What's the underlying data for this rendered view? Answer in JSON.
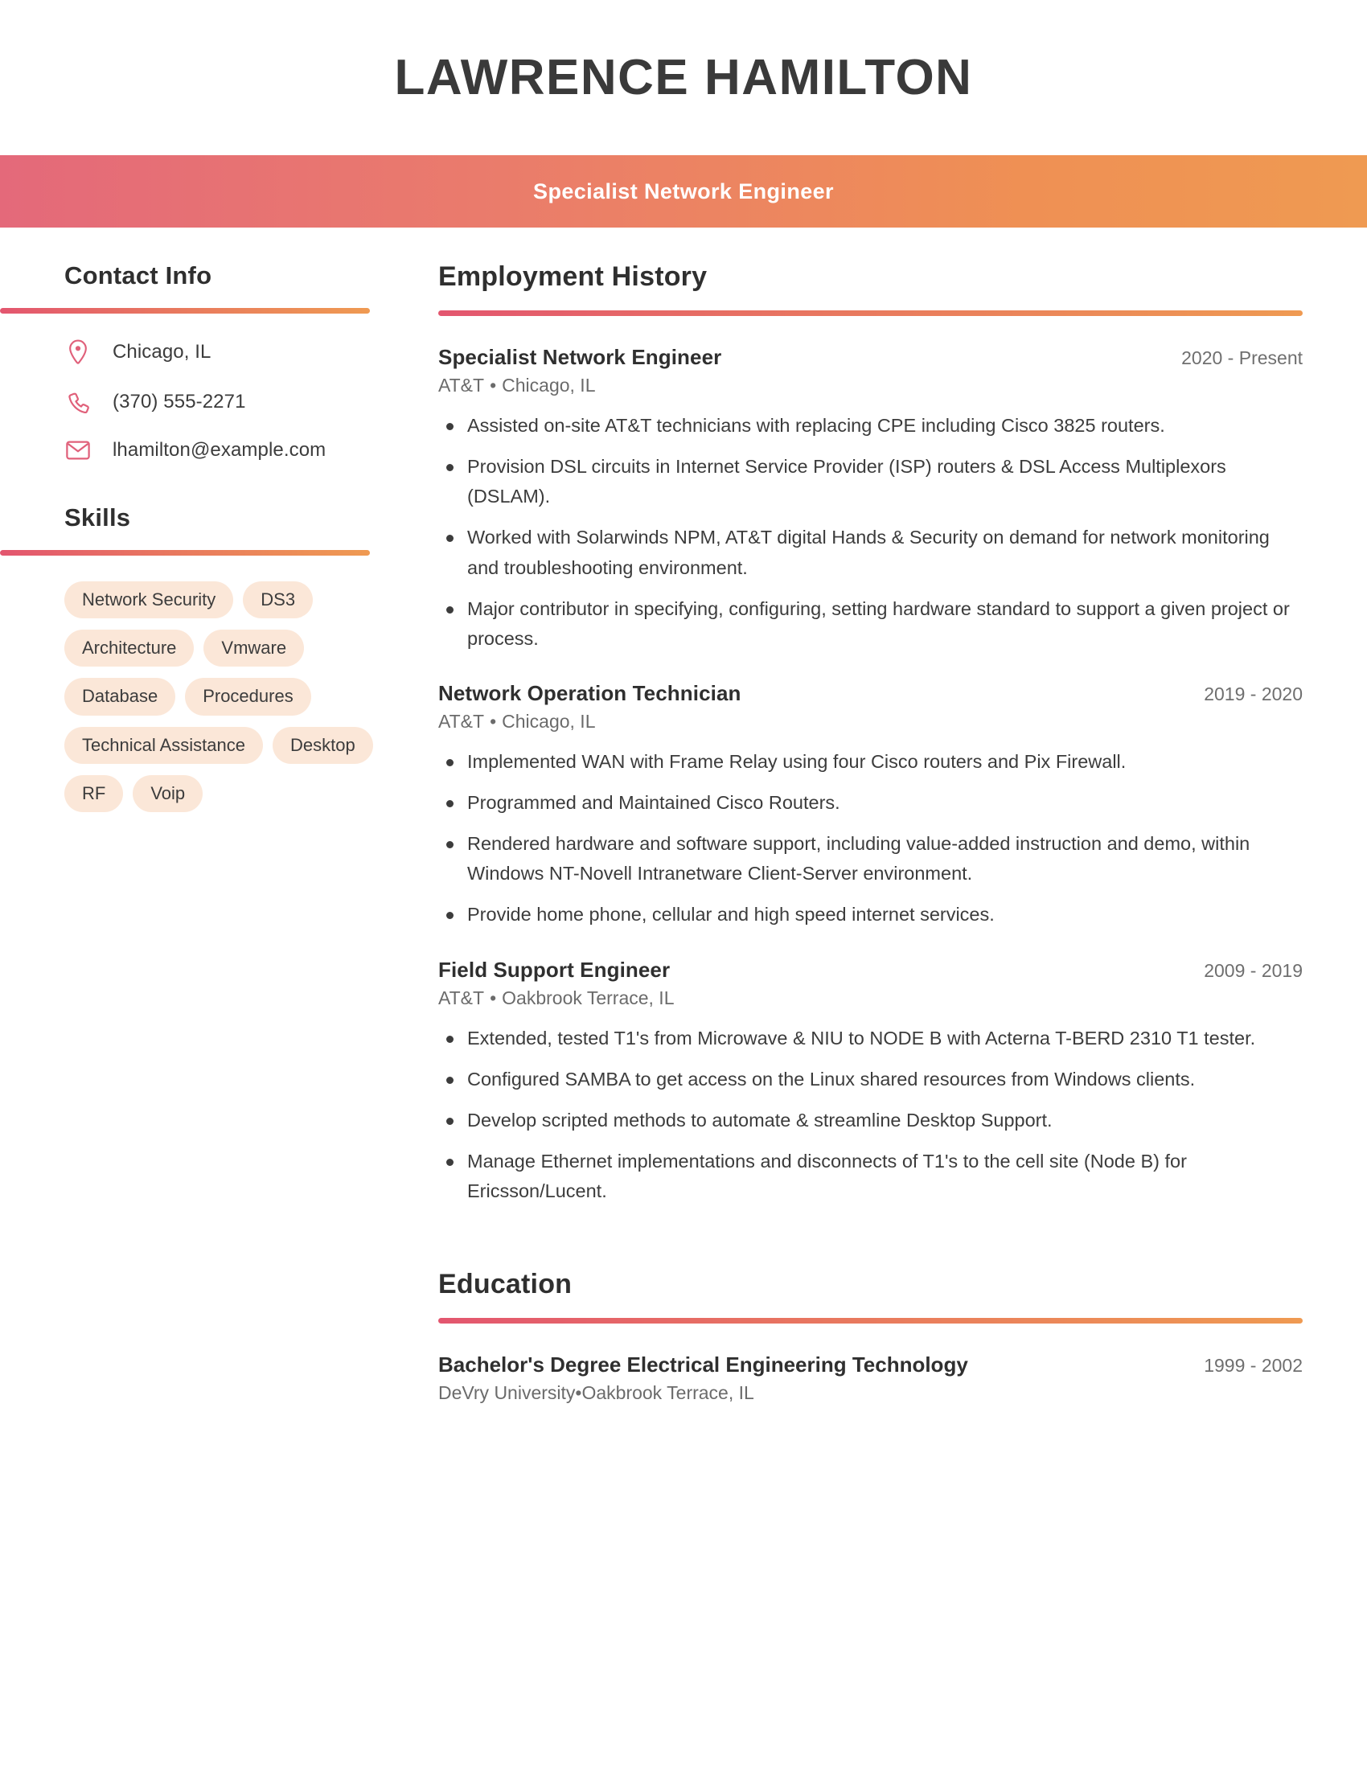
{
  "theme": {
    "gradient_start": "#e4697a",
    "gradient_end": "#ef9a52",
    "pill_bg": "#fbe7d8",
    "icon_color": "#e0607a",
    "heading_color": "#2f2f2f"
  },
  "header": {
    "name": "LAWRENCE HAMILTON",
    "title": "Specialist Network Engineer"
  },
  "sidebar": {
    "contact": {
      "heading": "Contact Info",
      "items": [
        {
          "icon": "map-pin-icon",
          "value": "Chicago, IL"
        },
        {
          "icon": "phone-icon",
          "value": "(370) 555-2271"
        },
        {
          "icon": "envelope-icon",
          "value": "lhamilton@example.com"
        }
      ]
    },
    "skills": {
      "heading": "Skills",
      "items": [
        "Network Security",
        "DS3",
        "Architecture",
        "Vmware",
        "Database",
        "Procedures",
        "Technical Assistance",
        "Desktop",
        "RF",
        "Voip"
      ]
    }
  },
  "main": {
    "employment": {
      "heading": "Employment History",
      "jobs": [
        {
          "title": "Specialist Network Engineer",
          "dates": "2020 - Present",
          "company": "AT&T",
          "location": "Chicago, IL",
          "bullets": [
            "Assisted on-site AT&T technicians with replacing CPE including Cisco 3825 routers.",
            "Provision DSL circuits in Internet Service Provider (ISP) routers & DSL Access Multiplexors (DSLAM).",
            "Worked with Solarwinds NPM, AT&T digital Hands & Security on demand for network monitoring and troubleshooting environment.",
            "Major contributor in specifying, configuring, setting hardware standard to support a given project or process."
          ]
        },
        {
          "title": "Network Operation Technician",
          "dates": "2019 - 2020",
          "company": "AT&T",
          "location": "Chicago, IL",
          "bullets": [
            "Implemented WAN with Frame Relay using four Cisco routers and Pix Firewall.",
            "Programmed and Maintained Cisco Routers.",
            "Rendered hardware and software support, including value-added instruction and demo, within Windows NT-Novell Intranetware Client-Server environment.",
            "Provide home phone, cellular and high speed internet services."
          ]
        },
        {
          "title": "Field Support Engineer",
          "dates": "2009 - 2019",
          "company": "AT&T",
          "location": "Oakbrook Terrace, IL",
          "bullets": [
            "Extended, tested T1's from Microwave & NIU to NODE B with Acterna T-BERD 2310 T1 tester.",
            "Configured SAMBA to get access on the Linux shared resources from Windows clients.",
            "Develop scripted methods to automate & streamline Desktop Support.",
            "Manage Ethernet implementations and disconnects of T1's to the cell site (Node B) for Ericsson/Lucent."
          ]
        }
      ]
    },
    "education": {
      "heading": "Education",
      "entries": [
        {
          "degree": "Bachelor's Degree Electrical Engineering Technology",
          "dates": "1999 - 2002",
          "school": "DeVry University",
          "location": "Oakbrook Terrace, IL"
        }
      ]
    }
  }
}
